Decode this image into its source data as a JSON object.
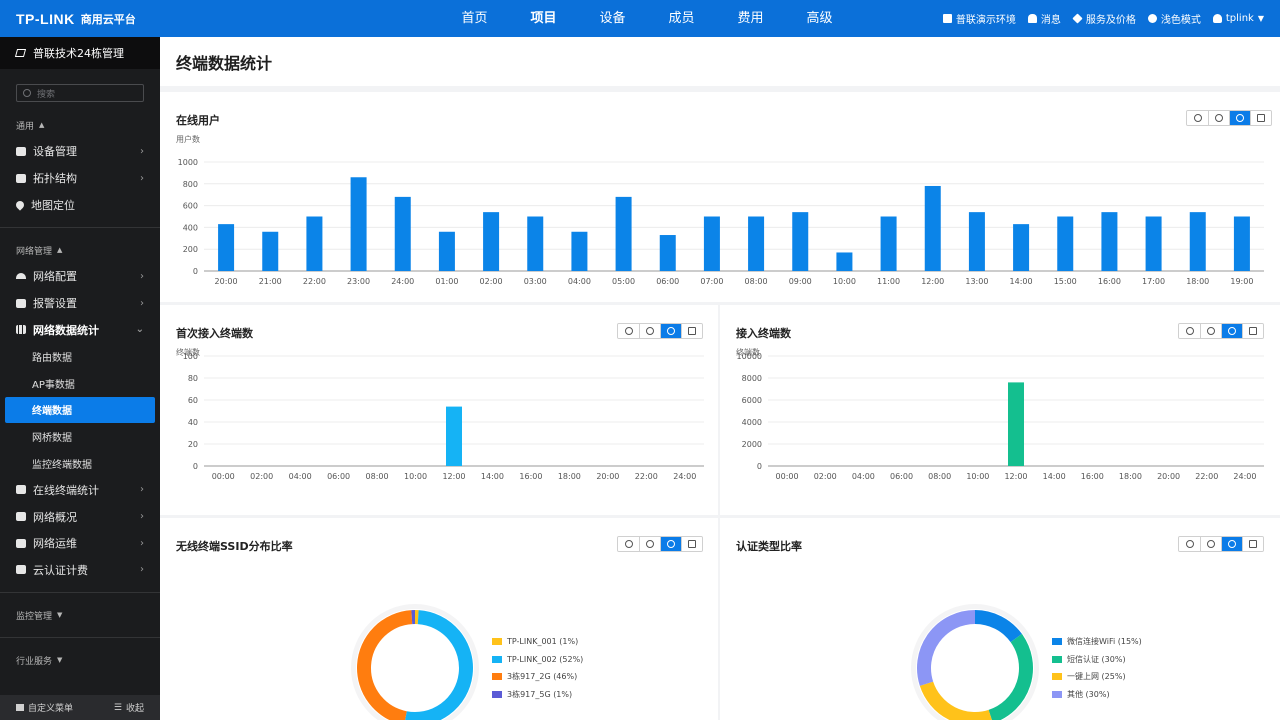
{
  "header": {
    "brand": "TP-LINK",
    "brand_sub": "商用云平台",
    "nav": [
      "首页",
      "项目",
      "设备",
      "成员",
      "费用",
      "高级"
    ],
    "active_nav": 1,
    "right_items": [
      "普联演示环境",
      "消息",
      "服务及价格",
      "浅色模式",
      "tplink"
    ]
  },
  "sidebar": {
    "project": "普联技术24栋管理",
    "search_placeholder": "搜索",
    "sections": {
      "general": "通用",
      "network": "网络管理",
      "monitor": "监控管理",
      "industry": "行业服务"
    },
    "general_items": [
      "设备管理",
      "拓扑结构",
      "地图定位"
    ],
    "network_items_top": [
      "网络配置",
      "报警设置",
      "网络数据统计"
    ],
    "stats_sub": [
      "路由数据",
      "AP事数据",
      "终端数据",
      "网桥数据",
      "监控终端数据"
    ],
    "network_items_bottom": [
      "在线终端统计",
      "网络概况",
      "网络运维",
      "云认证计费"
    ],
    "footer_left": "自定义菜单",
    "footer_right": "收起"
  },
  "page": {
    "title": "终端数据统计"
  },
  "panels": {
    "online": {
      "title": "在线用户",
      "y_unit": "用户数"
    },
    "first": {
      "title": "首次接入终端数",
      "y_unit": "终端数"
    },
    "access": {
      "title": "接入终端数",
      "y_unit": "终端数"
    },
    "ssid": {
      "title": "无线终端SSID分布比率"
    },
    "auth": {
      "title": "认证类型比率"
    }
  },
  "chart_data": [
    {
      "type": "bar",
      "title": "在线用户",
      "ylabel": "用户数",
      "ylim": [
        0,
        1000
      ],
      "yticks": [
        0,
        200,
        400,
        600,
        800,
        1000
      ],
      "categories": [
        "20:00",
        "21:00",
        "22:00",
        "23:00",
        "24:00",
        "01:00",
        "02:00",
        "03:00",
        "04:00",
        "05:00",
        "06:00",
        "07:00",
        "08:00",
        "09:00",
        "10:00",
        "11:00",
        "12:00",
        "13:00",
        "14:00",
        "15:00",
        "16:00",
        "17:00",
        "18:00",
        "19:00"
      ],
      "values": [
        430,
        360,
        500,
        860,
        680,
        360,
        540,
        500,
        360,
        680,
        330,
        500,
        500,
        540,
        170,
        500,
        780,
        540,
        430,
        500,
        540,
        500,
        540,
        500
      ],
      "color": "#0b84e8",
      "grid": true
    },
    {
      "type": "bar",
      "title": "首次接入终端数",
      "ylabel": "终端数",
      "ylim": [
        0,
        100
      ],
      "yticks": [
        0,
        20,
        40,
        60,
        80,
        100
      ],
      "categories": [
        "00:00",
        "02:00",
        "04:00",
        "06:00",
        "08:00",
        "10:00",
        "12:00",
        "14:00",
        "16:00",
        "18:00",
        "20:00",
        "22:00",
        "24:00"
      ],
      "values": [
        0,
        0,
        0,
        0,
        0,
        0,
        54,
        0,
        0,
        0,
        0,
        0,
        0
      ],
      "color": "#15b3f5",
      "grid": true
    },
    {
      "type": "bar",
      "title": "接入终端数",
      "ylabel": "终端数",
      "ylim": [
        0,
        10000
      ],
      "yticks": [
        0,
        2000,
        4000,
        6000,
        8000,
        10000
      ],
      "categories": [
        "00:00",
        "02:00",
        "04:00",
        "06:00",
        "08:00",
        "10:00",
        "12:00",
        "14:00",
        "16:00",
        "18:00",
        "20:00",
        "22:00",
        "24:00"
      ],
      "values": [
        0,
        0,
        0,
        0,
        0,
        0,
        7600,
        0,
        0,
        0,
        0,
        0,
        0
      ],
      "color": "#14bf8f",
      "grid": true
    },
    {
      "type": "pie",
      "title": "无线终端SSID分布比率",
      "slices": [
        {
          "label": "TP-LINK_001 (1%)",
          "value": 1,
          "color": "#ffc21a"
        },
        {
          "label": "TP-LINK_002 (52%)",
          "value": 52,
          "color": "#15b3f5"
        },
        {
          "label": "3栋917_2G (46%)",
          "value": 46,
          "color": "#ff7d0f"
        },
        {
          "label": "3栋917_5G (1%)",
          "value": 1,
          "color": "#5b5bd6"
        }
      ]
    },
    {
      "type": "pie",
      "title": "认证类型比率",
      "slices": [
        {
          "label": "微信连接WiFi (15%)",
          "value": 15,
          "color": "#0b84e8"
        },
        {
          "label": "短信认证 (30%)",
          "value": 30,
          "color": "#14bf8f"
        },
        {
          "label": "一键上网 (25%)",
          "value": 25,
          "color": "#ffc21a"
        },
        {
          "label": "其他 (30%)",
          "value": 30,
          "color": "#8c96f5"
        }
      ]
    }
  ]
}
